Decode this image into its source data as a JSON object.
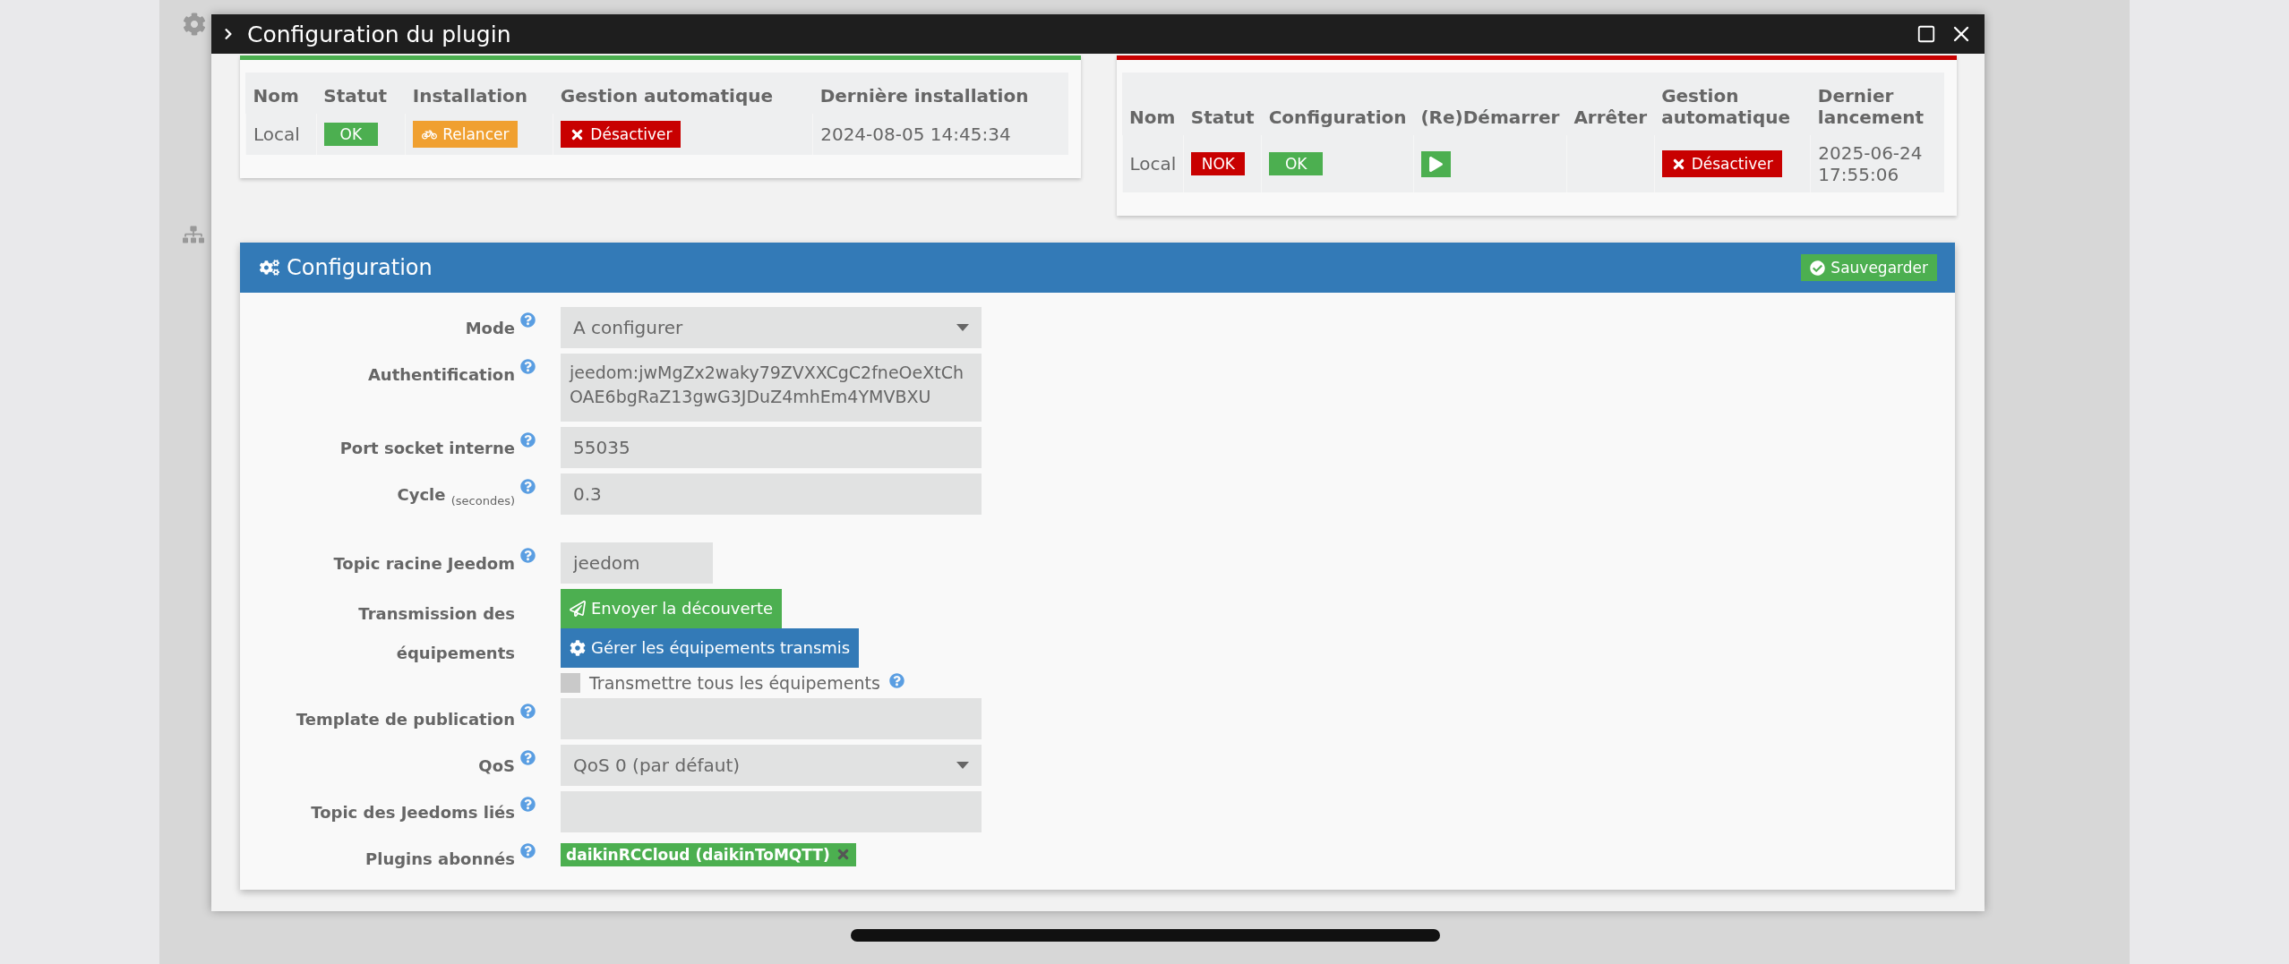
{
  "modal": {
    "title": "Configuration du plugin"
  },
  "panels": [
    {
      "color": "#4caf50",
      "columns": [
        "Nom",
        "Statut",
        "Installation",
        "Gestion automatique",
        "Dernière installation"
      ],
      "rows": [
        [
          {
            "kind": "text",
            "text": "Local"
          },
          {
            "kind": "badge",
            "text": "OK",
            "color": "#4caf50"
          },
          {
            "kind": "relaunch",
            "text": "Relancer"
          },
          {
            "kind": "disable",
            "text": "Désactiver"
          },
          {
            "kind": "text",
            "text": "2024-08-05 14:45:34"
          }
        ]
      ]
    },
    {
      "color": "#c80000",
      "columns": [
        "Nom",
        "Statut",
        "Configuration",
        "(Re)Démarrer",
        "Arrêter",
        "Gestion automatique",
        "Dernier lancement"
      ],
      "rows": [
        [
          {
            "kind": "text",
            "text": "Local"
          },
          {
            "kind": "badge",
            "text": "NOK",
            "color": "#c80000"
          },
          {
            "kind": "badge",
            "text": "OK",
            "color": "#4caf50"
          },
          {
            "kind": "play"
          },
          {
            "kind": "empty"
          },
          {
            "kind": "disable",
            "text": "Désactiver"
          },
          {
            "kind": "text",
            "text": "2025-06-24 17:55:06"
          }
        ]
      ]
    }
  ],
  "config": {
    "title": "Configuration",
    "save_label": "Sauvegarder",
    "groups": [
      [
        {
          "kind": "select",
          "label": "Mode",
          "help": true,
          "value": "A configurer"
        },
        {
          "kind": "textarea",
          "label": "Authentification",
          "help": true,
          "value": "jeedom:jwMgZx2waky79ZVXXCgC2fneOeXtChOAE6bgRaZ13gwG3JDuZ4mhEm4YMVBXU"
        },
        {
          "kind": "text",
          "label": "Port socket interne",
          "help": true,
          "value": "55035"
        },
        {
          "kind": "text",
          "label": "Cycle $_{(secondes)}$",
          "help": true,
          "value": "0.3"
        }
      ],
      [
        {
          "kind": "short",
          "label": "Topic racine Jeedom",
          "help": true,
          "value": "jeedom"
        },
        {
          "kind": "actions",
          "label": "Transmission des équipements",
          "help": false,
          "buttons": [
            {
              "kind": "send",
              "text": "Envoyer la découverte"
            },
            {
              "kind": "manage",
              "text": "Gérer les équipements transmis"
            }
          ],
          "checkbox": {
            "label": "Transmettre tous les équipements",
            "checked": false,
            "help": true
          }
        },
        {
          "kind": "text",
          "label": "Template de publication",
          "help": true
        },
        {
          "kind": "select",
          "label": "QoS",
          "help": true,
          "value": "QoS 0 (par défaut)"
        },
        {
          "kind": "text",
          "label": "Topic des Jeedoms liés",
          "help": true
        },
        {
          "kind": "tags",
          "label": "Plugins abonnés",
          "help": true,
          "tags": [
            "daikinRCCloud (daikinToMQTT)"
          ]
        }
      ]
    ]
  }
}
